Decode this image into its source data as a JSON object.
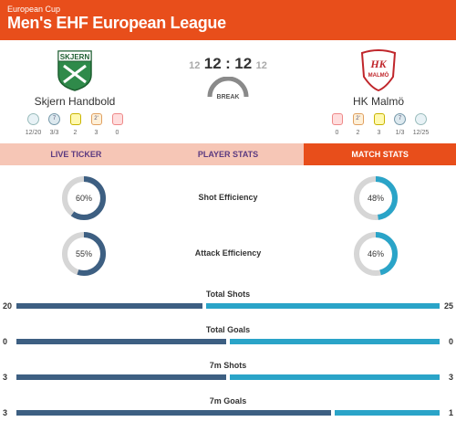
{
  "header": {
    "subtitle": "European Cup",
    "title": "Men's EHF European League"
  },
  "home": {
    "name": "Skjern Handbold",
    "logo_text": "SKJERN",
    "stats": [
      {
        "icon": "timeout-icon",
        "value": "12/20"
      },
      {
        "icon": "seven-meter-icon",
        "value": "3/3"
      },
      {
        "icon": "yellow-card-icon",
        "value": "2"
      },
      {
        "icon": "two-minute-icon",
        "value": "3"
      },
      {
        "icon": "red-card-icon",
        "value": "0"
      }
    ]
  },
  "away": {
    "name": "HK Malmö",
    "logo_text": "HK",
    "logo_sub": "MALMÖ",
    "stats": [
      {
        "icon": "red-card-icon",
        "value": "0"
      },
      {
        "icon": "two-minute-icon",
        "value": "2"
      },
      {
        "icon": "yellow-card-icon",
        "value": "3"
      },
      {
        "icon": "seven-meter-icon",
        "value": "1/3"
      },
      {
        "icon": "timeout-icon",
        "value": "12/25"
      }
    ]
  },
  "score": {
    "home_ht": "12",
    "home": "12",
    "sep": ":",
    "away": "12",
    "away_ht": "12",
    "status": "BREAK"
  },
  "tabs": [
    "LIVE TICKER",
    "PLAYER STATS",
    "MATCH STATS"
  ],
  "efficiency": [
    {
      "label": "Shot Efficiency",
      "home": 60,
      "away": 48,
      "home_text": "60%",
      "away_text": "48%"
    },
    {
      "label": "Attack Efficiency",
      "home": 55,
      "away": 46,
      "home_text": "55%",
      "away_text": "46%"
    }
  ],
  "bars": [
    {
      "label": "Total Shots",
      "home": 20,
      "away": 25,
      "home_text": "20",
      "away_text": "25"
    },
    {
      "label": "Total Goals",
      "home": 0,
      "away": 0,
      "home_text": "0",
      "away_text": "0"
    },
    {
      "label": "7m Shots",
      "home": 3,
      "away": 3,
      "home_text": "3",
      "away_text": "3"
    },
    {
      "label": "7m Goals",
      "home": 3,
      "away": 1,
      "home_text": "3",
      "away_text": "1"
    }
  ],
  "colors": {
    "accent": "#e84e1b",
    "tab_bg": "#f6c6b6",
    "home_bar": "#3d5f82",
    "away_bar": "#2aa4c8",
    "ring_track": "#d6d6d6"
  }
}
